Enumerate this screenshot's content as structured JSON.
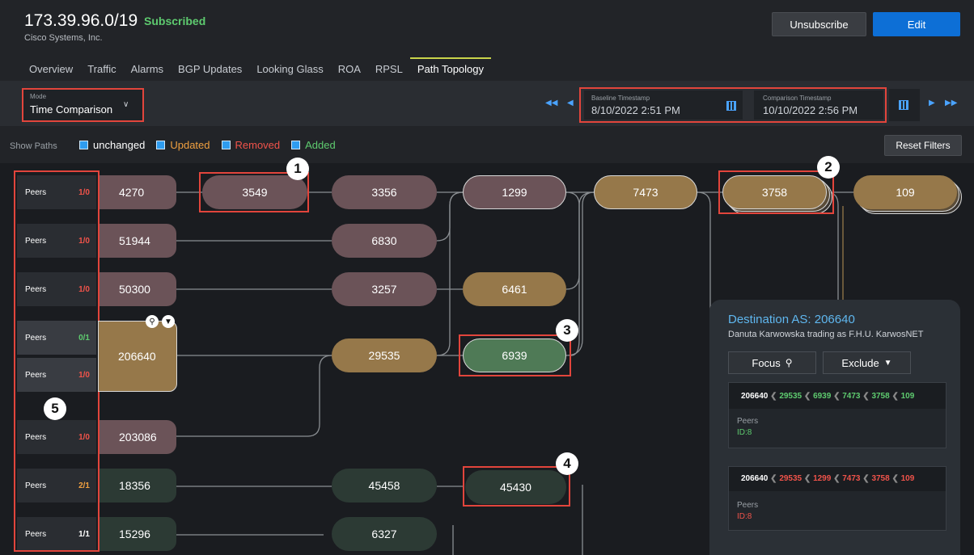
{
  "header": {
    "prefix": "173.39.96.0/19",
    "status": "Subscribed",
    "org": "Cisco Systems, Inc.",
    "unsubscribe_label": "Unsubscribe",
    "edit_label": "Edit"
  },
  "tabs": [
    {
      "label": "Overview"
    },
    {
      "label": "Traffic"
    },
    {
      "label": "Alarms"
    },
    {
      "label": "BGP Updates"
    },
    {
      "label": "Looking Glass"
    },
    {
      "label": "ROA"
    },
    {
      "label": "RPSL"
    },
    {
      "label": "Path Topology",
      "active": true
    }
  ],
  "toolbar": {
    "mode_label": "Mode",
    "mode_value": "Time Comparison",
    "baseline_label": "Baseline Timestamp",
    "baseline_value": "8/10/2022 2:51 PM",
    "comparison_label": "Comparison Timestamp",
    "comparison_value": "10/10/2022 2:56 PM"
  },
  "filters": {
    "show_paths_label": "Show Paths",
    "unchanged": "unchanged",
    "updated": "Updated",
    "removed": "Removed",
    "added": "Added",
    "reset_label": "Reset Filters",
    "colors": {
      "updated": "#f0a040",
      "removed": "#f0534a",
      "added": "#5ecb6f"
    }
  },
  "peers": [
    {
      "label": "Peers",
      "value": "1/0",
      "status": "removed"
    },
    {
      "label": "Peers",
      "value": "1/0",
      "status": "removed"
    },
    {
      "label": "Peers",
      "value": "1/0",
      "status": "removed"
    },
    {
      "label": "Peers",
      "value": "0/1",
      "status": "added"
    },
    {
      "label": "Peers",
      "value": "1/0",
      "status": "removed"
    },
    {
      "label": "Peers",
      "value": "1/0",
      "status": "removed"
    },
    {
      "label": "Peers",
      "value": "2/1",
      "status": "updated"
    },
    {
      "label": "Peers",
      "value": "1/1",
      "status": "unchanged"
    }
  ],
  "nodes": {
    "n4270": "4270",
    "n51944": "51944",
    "n50300": "50300",
    "n206640": "206640",
    "n203086": "203086",
    "n18356": "18356",
    "n15296": "15296",
    "n3549": "3549",
    "n3356": "3356",
    "n6830": "6830",
    "n3257": "3257",
    "n29535": "29535",
    "n45458": "45458",
    "n6327": "6327",
    "n1299": "1299",
    "n6461": "6461",
    "n6939": "6939",
    "n45430": "45430",
    "n7473": "7473",
    "n3758": "3758",
    "n109": "109"
  },
  "callouts": {
    "c1": "1",
    "c2": "2",
    "c3": "3",
    "c4": "4",
    "c5": "5"
  },
  "detail": {
    "title": "Destination AS: 206640",
    "org": "Danuta Karwowska trading as F.H.U. KarwosNET",
    "focus_label": "Focus",
    "exclude_label": "Exclude",
    "cards": [
      {
        "path": [
          "206640",
          "29535",
          "6939",
          "7473",
          "3758",
          "109"
        ],
        "status": "added",
        "peers_label": "Peers",
        "id": "ID:8"
      },
      {
        "path": [
          "206640",
          "29535",
          "1299",
          "7473",
          "3758",
          "109"
        ],
        "status": "removed",
        "peers_label": "Peers",
        "id": "ID:8"
      }
    ]
  }
}
